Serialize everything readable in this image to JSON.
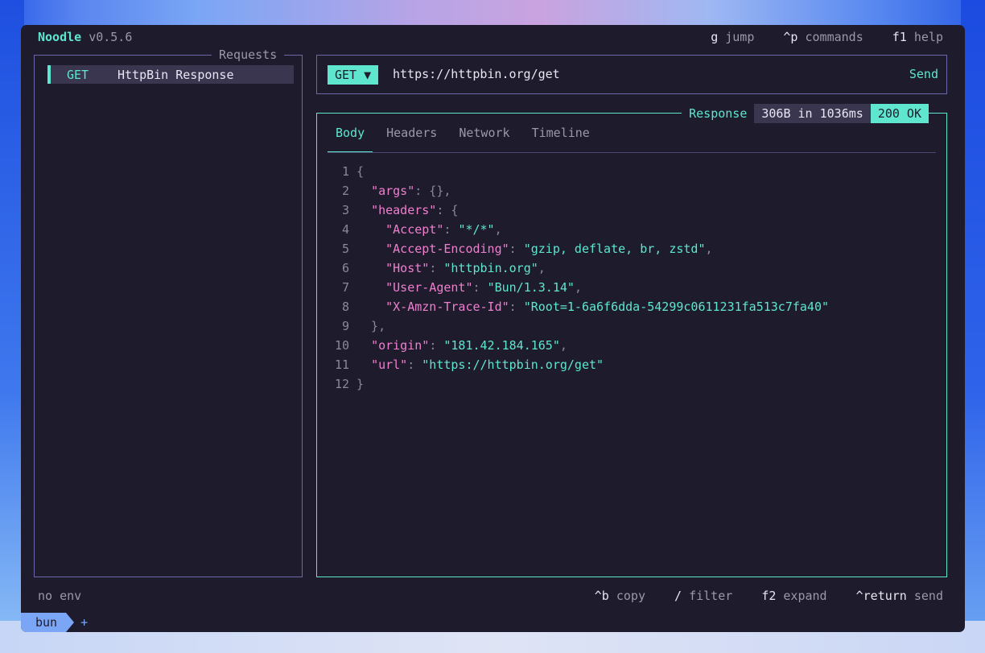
{
  "app": {
    "name": "Noodle",
    "version": "v0.5.6"
  },
  "topbar": {
    "shortcuts": [
      {
        "key": "g",
        "label": "jump"
      },
      {
        "key": "^p",
        "label": "commands"
      },
      {
        "key": "f1",
        "label": "help"
      }
    ]
  },
  "requests": {
    "title": "Requests",
    "items": [
      {
        "method": "GET",
        "name": "HttpBin Response"
      }
    ]
  },
  "url_bar": {
    "method": "GET",
    "dropdown_icon": "▼",
    "url": "https://httpbin.org/get",
    "send_label": "Send"
  },
  "response": {
    "label": "Response",
    "size_time": "306B in 1036ms",
    "status": "200 OK",
    "tabs": [
      "Body",
      "Headers",
      "Network",
      "Timeline"
    ],
    "active_tab": "Body",
    "lines": [
      {
        "n": "1",
        "parts": [
          [
            "pun",
            "{"
          ]
        ]
      },
      {
        "n": "2",
        "parts": [
          [
            "pun",
            "  "
          ],
          [
            "key",
            "\"args\""
          ],
          [
            "pun",
            ": {},"
          ]
        ]
      },
      {
        "n": "3",
        "parts": [
          [
            "pun",
            "  "
          ],
          [
            "key",
            "\"headers\""
          ],
          [
            "pun",
            ": {"
          ]
        ]
      },
      {
        "n": "4",
        "parts": [
          [
            "pun",
            "    "
          ],
          [
            "key",
            "\"Accept\""
          ],
          [
            "pun",
            ": "
          ],
          [
            "str",
            "\"*/*\""
          ],
          [
            "pun",
            ","
          ]
        ]
      },
      {
        "n": "5",
        "parts": [
          [
            "pun",
            "    "
          ],
          [
            "key",
            "\"Accept-Encoding\""
          ],
          [
            "pun",
            ": "
          ],
          [
            "str",
            "\"gzip, deflate, br, zstd\""
          ],
          [
            "pun",
            ","
          ]
        ]
      },
      {
        "n": "6",
        "parts": [
          [
            "pun",
            "    "
          ],
          [
            "key",
            "\"Host\""
          ],
          [
            "pun",
            ": "
          ],
          [
            "str",
            "\"httpbin.org\""
          ],
          [
            "pun",
            ","
          ]
        ]
      },
      {
        "n": "7",
        "parts": [
          [
            "pun",
            "    "
          ],
          [
            "key",
            "\"User-Agent\""
          ],
          [
            "pun",
            ": "
          ],
          [
            "str",
            "\"Bun/1.3.14\""
          ],
          [
            "pun",
            ","
          ]
        ]
      },
      {
        "n": "8",
        "parts": [
          [
            "pun",
            "    "
          ],
          [
            "key",
            "\"X-Amzn-Trace-Id\""
          ],
          [
            "pun",
            ": "
          ],
          [
            "str",
            "\"Root=1-6a6f6dda-54299c0611231fa513c7fa40\""
          ]
        ]
      },
      {
        "n": "9",
        "parts": [
          [
            "pun",
            "  },"
          ]
        ]
      },
      {
        "n": "10",
        "parts": [
          [
            "pun",
            "  "
          ],
          [
            "key",
            "\"origin\""
          ],
          [
            "pun",
            ": "
          ],
          [
            "str",
            "\"181.42.184.165\""
          ],
          [
            "pun",
            ","
          ]
        ]
      },
      {
        "n": "11",
        "parts": [
          [
            "pun",
            "  "
          ],
          [
            "key",
            "\"url\""
          ],
          [
            "pun",
            ": "
          ],
          [
            "str",
            "\"https://httpbin.org/get\""
          ]
        ]
      },
      {
        "n": "12",
        "parts": [
          [
            "pun",
            "}"
          ]
        ]
      }
    ]
  },
  "footer": {
    "env": "no env",
    "shortcuts": [
      {
        "key": "^b",
        "label": "copy"
      },
      {
        "key": "/",
        "label": "filter"
      },
      {
        "key": "f2",
        "label": "expand"
      },
      {
        "key": "^return",
        "label": "send"
      }
    ]
  },
  "bottom_tabs": {
    "tab_label": "bun",
    "add_label": "+"
  },
  "colors": {
    "accent": "#5ee6cf",
    "key": "#f07fcf",
    "bg": "#1e1b2c",
    "border": "#6a68a8"
  }
}
